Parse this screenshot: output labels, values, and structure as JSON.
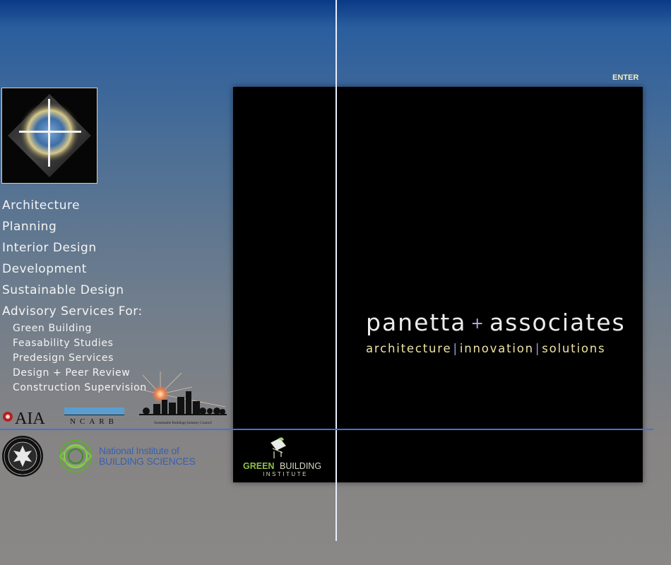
{
  "header": {
    "enter_label": "ENTER"
  },
  "nav": {
    "items": [
      {
        "label": "Architecture"
      },
      {
        "label": "Planning"
      },
      {
        "label": "Interior Design"
      },
      {
        "label": "Development"
      },
      {
        "label": "Sustainable Design"
      }
    ],
    "advisory_label": "Advisory Services For:",
    "sub_items": [
      {
        "label": "Green Building"
      },
      {
        "label": "Feasability Studies"
      },
      {
        "label": "Predesign Services"
      },
      {
        "label": "Design + Peer Review"
      },
      {
        "label": "Construction Supervision"
      }
    ]
  },
  "brand": {
    "name_left": "panetta",
    "plus": "+",
    "name_right": "associates",
    "tag1": "architecture",
    "tag2": "innovation",
    "tag3": "solutions",
    "sep": "|"
  },
  "badges": {
    "aia": "AIA",
    "ncarb": "NCARB",
    "sbic": "Sustainable Buildings Industry Council",
    "usgbc": "U.S. GREEN BUILDING COUNCIL MEMBER",
    "nibs_line1": "National Institute of",
    "nibs_line2": "BUILDING SCIENCES",
    "gbi_green": "GREEN",
    "gbi_building": "BUILDING",
    "gbi_institute": "INSTITUTE"
  },
  "colors": {
    "accent_gold": "#efe3a4",
    "accent_violet": "#9f9ce8",
    "divider_blue": "#3a6fd6"
  }
}
